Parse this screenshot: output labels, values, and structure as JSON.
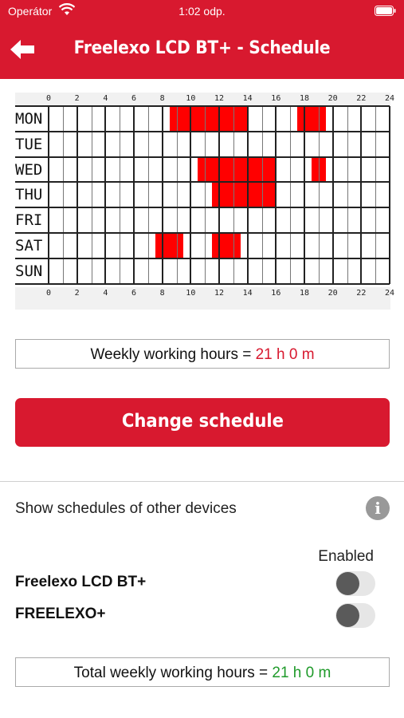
{
  "status_bar": {
    "carrier": "Operátor",
    "time": "1:02 odp."
  },
  "nav": {
    "title": "Freelexo LCD BT+ - Schedule"
  },
  "schedule": {
    "hour_ticks": [
      "0",
      "2",
      "4",
      "6",
      "8",
      "10",
      "12",
      "14",
      "16",
      "18",
      "20",
      "22",
      "24"
    ],
    "days": [
      {
        "label": "MON",
        "blocks": [
          [
            8.5,
            12.0
          ],
          [
            12.0,
            14.0
          ],
          [
            17.5,
            19.5
          ]
        ]
      },
      {
        "label": "TUE",
        "blocks": []
      },
      {
        "label": "WED",
        "blocks": [
          [
            10.5,
            12.0
          ],
          [
            12.0,
            16.0
          ],
          [
            18.5,
            19.5
          ]
        ]
      },
      {
        "label": "THU",
        "blocks": [
          [
            11.5,
            12.0
          ],
          [
            12.0,
            16.0
          ]
        ]
      },
      {
        "label": "FRI",
        "blocks": []
      },
      {
        "label": "SAT",
        "blocks": [
          [
            7.5,
            8.5
          ],
          [
            8.5,
            9.5
          ],
          [
            11.5,
            12.5
          ],
          [
            12.5,
            13.5
          ]
        ]
      },
      {
        "label": "SUN",
        "blocks": []
      }
    ],
    "active_color": "#ff0000"
  },
  "weekly": {
    "label": "Weekly working hours = ",
    "value": "21 h 0 m"
  },
  "change_button": {
    "label": "Change schedule"
  },
  "other_devices": {
    "label": "Show schedules of other devices",
    "enabled_header": "Enabled",
    "devices": [
      {
        "name": "Freelexo LCD BT+",
        "enabled": false
      },
      {
        "name": "FREELEXO+",
        "enabled": false
      }
    ]
  },
  "total": {
    "label": "Total weekly working hours = ",
    "value": "21 h 0 m"
  },
  "colors": {
    "brand": "#d8192f",
    "value_red": "#d8192f",
    "value_green": "#1f9a2a"
  }
}
